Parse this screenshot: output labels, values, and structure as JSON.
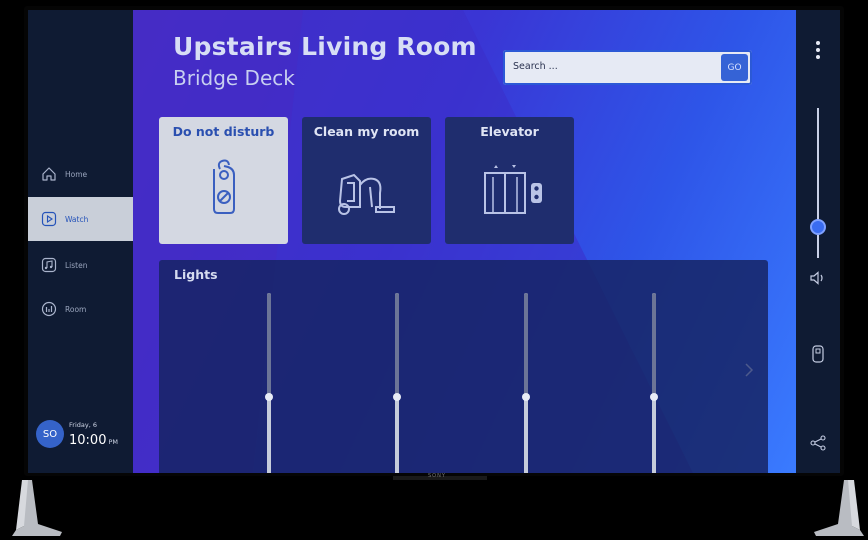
{
  "nav": {
    "items": [
      {
        "label": "Home",
        "icon": "home-icon"
      },
      {
        "label": "Watch",
        "icon": "play-icon",
        "active": true
      },
      {
        "label": "Listen",
        "icon": "music-icon"
      },
      {
        "label": "Room",
        "icon": "room-icon"
      }
    ]
  },
  "user": {
    "initials": "SO",
    "date": "Friday, 6",
    "time": "10:00",
    "ampm": "PM"
  },
  "header": {
    "title": "Upstairs Living Room",
    "subtitle": "Bridge Deck"
  },
  "search": {
    "placeholder": "Search ...",
    "go_label": "GO"
  },
  "tiles": [
    {
      "label": "Do not disturb",
      "icon": "door-hanger-icon",
      "selected": true
    },
    {
      "label": "Clean my room",
      "icon": "vacuum-icon"
    },
    {
      "label": "Elevator",
      "icon": "elevator-icon"
    }
  ],
  "lights": {
    "title": "Lights",
    "sliders": [
      {
        "level": 0.45
      },
      {
        "level": 0.45
      },
      {
        "level": 0.45
      },
      {
        "level": 0.45
      }
    ]
  },
  "volume": {
    "level": 0.15
  },
  "brand": {
    "label": "SONY"
  },
  "colors": {
    "accent": "#3563d6",
    "nav_active_bg": "#c9cfd9",
    "panel": "#0f1b33"
  }
}
